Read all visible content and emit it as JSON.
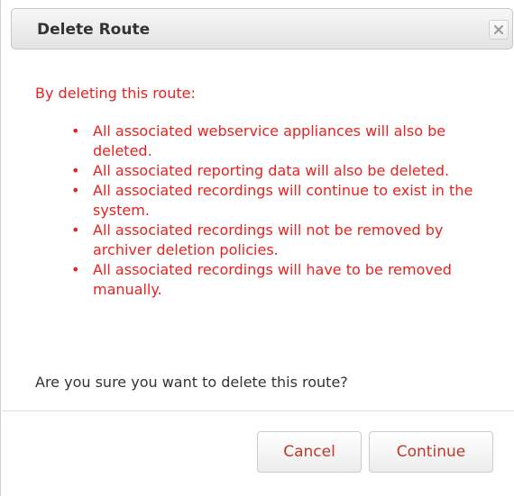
{
  "dialog": {
    "title": "Delete Route",
    "close_icon": "close-icon",
    "intro": "By deleting this route:",
    "bullets": [
      "All associated webservice appliances will also be deleted.",
      "All associated reporting data will also be deleted.",
      "All associated recordings will continue to exist in the system.",
      "All associated recordings will not be removed by archiver deletion policies.",
      "All associated recordings will have to be removed manually."
    ],
    "question": "Are you sure you want to delete this route?",
    "cancel_label": "Cancel",
    "continue_label": "Continue"
  },
  "colors": {
    "warning_text": "#e8231f",
    "body_text": "#333333",
    "button_text": "#c0392b"
  }
}
